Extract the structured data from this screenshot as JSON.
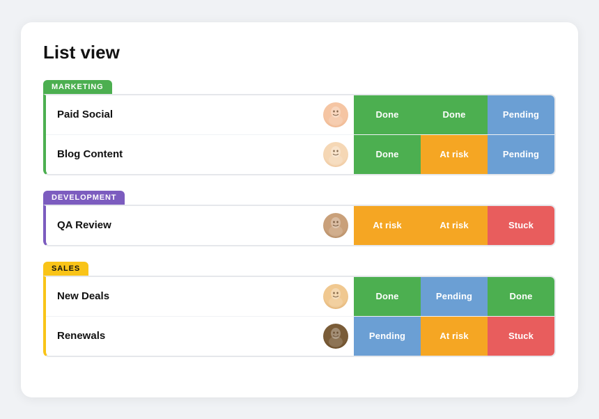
{
  "page": {
    "title": "List view"
  },
  "groups": [
    {
      "id": "marketing",
      "label": "MARKETING",
      "color_class": "group-marketing",
      "rows": [
        {
          "name": "Paid Social",
          "avatar_class": "avatar-f1",
          "statuses": [
            "Done",
            "Done",
            "Pending"
          ]
        },
        {
          "name": "Blog Content",
          "avatar_class": "avatar-f2",
          "statuses": [
            "Done",
            "At risk",
            "Pending"
          ]
        }
      ]
    },
    {
      "id": "development",
      "label": "DEVELOPMENT",
      "color_class": "group-development",
      "rows": [
        {
          "name": "QA Review",
          "avatar_class": "avatar-m1",
          "statuses": [
            "At risk",
            "At risk",
            "Stuck"
          ]
        }
      ]
    },
    {
      "id": "sales",
      "label": "SALES",
      "color_class": "group-sales",
      "rows": [
        {
          "name": "New Deals",
          "avatar_class": "avatar-m2",
          "statuses": [
            "Done",
            "Pending",
            "Done"
          ]
        },
        {
          "name": "Renewals",
          "avatar_class": "avatar-m3",
          "statuses": [
            "Pending",
            "At risk",
            "Stuck"
          ]
        }
      ]
    }
  ],
  "status_class_map": {
    "Done": "status-done",
    "Pending": "status-pending",
    "At risk": "status-at-risk",
    "Stuck": "status-stuck"
  }
}
